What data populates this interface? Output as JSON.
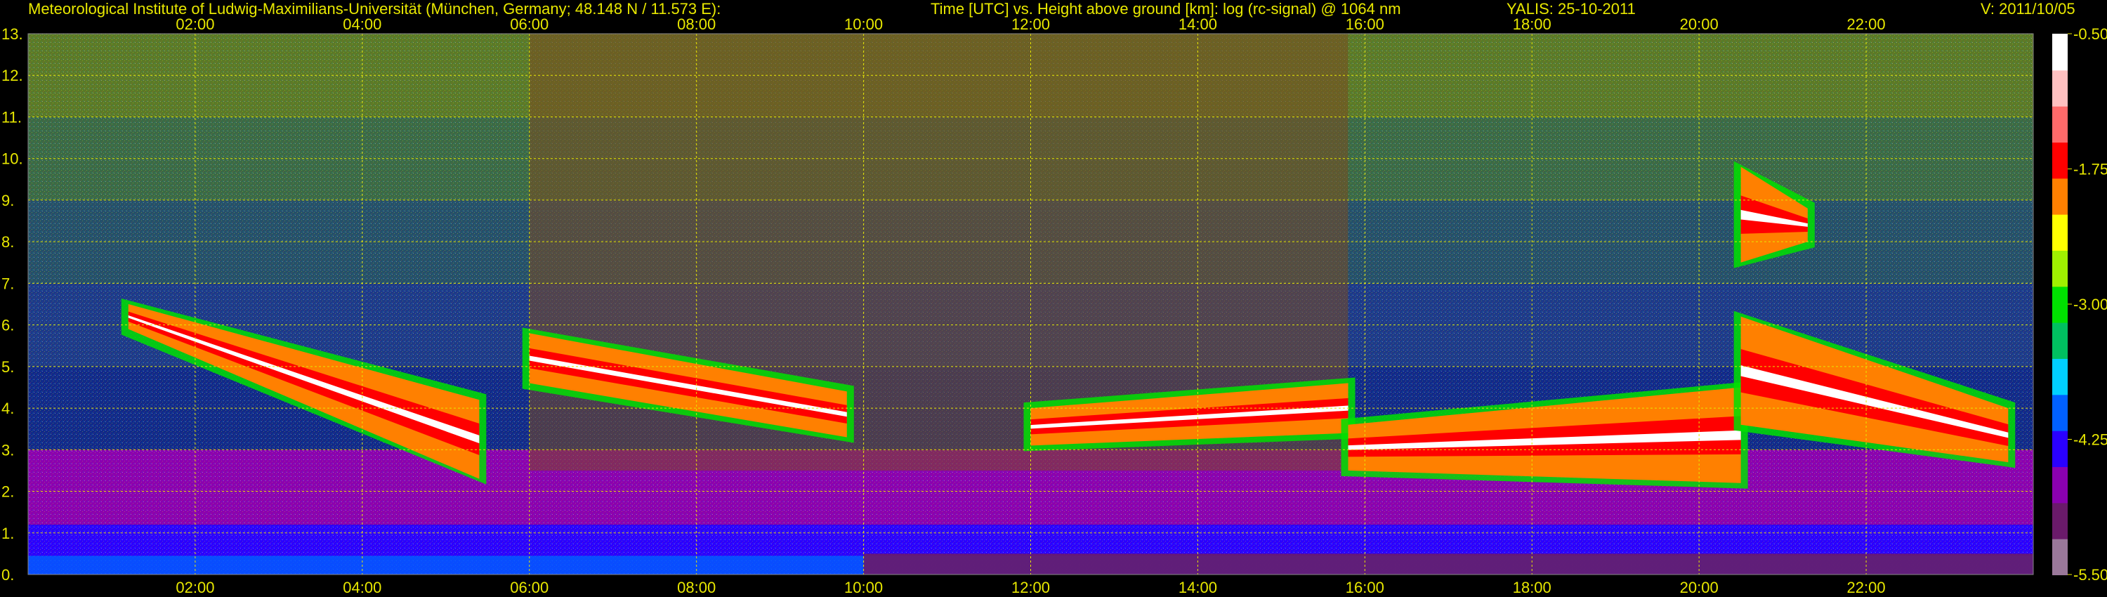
{
  "header": {
    "institute": "Meteorological Institute of Ludwig-Maximilians-Universität (München, Germany; 48.148 N / 11.573 E):",
    "description": "Time [UTC] vs. Height above ground [km]: log (rc-signal) @ 1064 nm",
    "station": "YALIS: 25-10-2011",
    "version": "V: 2011/10/05"
  },
  "colors": {
    "text": "#e8e800",
    "grid": "#e8e800",
    "background": "#000000"
  },
  "chart_data": {
    "type": "heatmap",
    "title": "Time [UTC] vs. Height above ground [km]: log (rc-signal) @ 1064 nm",
    "x_unit": "Time [UTC]",
    "y_unit": "Height above ground [km]",
    "xlim_hours": [
      0.0,
      24.0
    ],
    "ylim_km": [
      0,
      13
    ],
    "x_ticks": [
      "02:00",
      "04:00",
      "06:00",
      "08:00",
      "10:00",
      "12:00",
      "14:00",
      "16:00",
      "18:00",
      "20:00",
      "22:00"
    ],
    "x_tick_hours": [
      2,
      4,
      6,
      8,
      10,
      12,
      14,
      16,
      18,
      20,
      22
    ],
    "y_ticks": [
      "0.",
      "1.",
      "2.",
      "3.",
      "4.",
      "5.",
      "6.",
      "7.",
      "8.",
      "9.",
      "10.",
      "11.",
      "12.",
      "13."
    ],
    "grid": true,
    "colorbar": {
      "ticks": [
        "-0.50",
        "-1.75",
        "-3.00",
        "-4.25",
        "-5.50"
      ],
      "values": [
        -0.5,
        -1.75,
        -3.0,
        -4.25,
        -5.5
      ],
      "range": [
        -5.5,
        -0.5
      ],
      "colors": [
        "#9a789a",
        "#6a1a6a",
        "#8a00b0",
        "#2a00ff",
        "#0060ff",
        "#00d0ff",
        "#00c060",
        "#00e000",
        "#a0f000",
        "#ffff00",
        "#ff8000",
        "#ff0000",
        "#ff6a6a",
        "#ffc0c0",
        "#ffffff"
      ]
    },
    "cloud_layers": [
      {
        "start_h": 1.2,
        "end_h": 5.4,
        "base_km_start": 5.9,
        "base_km_end": 2.3,
        "top_km_start": 6.5,
        "top_km_end": 4.2
      },
      {
        "start_h": 6.0,
        "end_h": 9.8,
        "base_km_start": 4.6,
        "base_km_end": 3.3,
        "top_km_start": 5.8,
        "top_km_end": 4.4
      },
      {
        "start_h": 12.0,
        "end_h": 15.8,
        "base_km_start": 3.1,
        "base_km_end": 3.4,
        "top_km_start": 4.0,
        "top_km_end": 4.6
      },
      {
        "start_h": 15.8,
        "end_h": 20.5,
        "base_km_start": 2.5,
        "base_km_end": 2.2,
        "top_km_start": 3.6,
        "top_km_end": 4.5
      },
      {
        "start_h": 20.5,
        "end_h": 23.7,
        "base_km_start": 3.6,
        "base_km_end": 2.7,
        "top_km_start": 6.2,
        "top_km_end": 4.0
      },
      {
        "start_h": 20.5,
        "end_h": 21.3,
        "base_km_start": 7.5,
        "base_km_end": 8.0,
        "top_km_start": 9.8,
        "top_km_end": 8.8
      }
    ]
  }
}
